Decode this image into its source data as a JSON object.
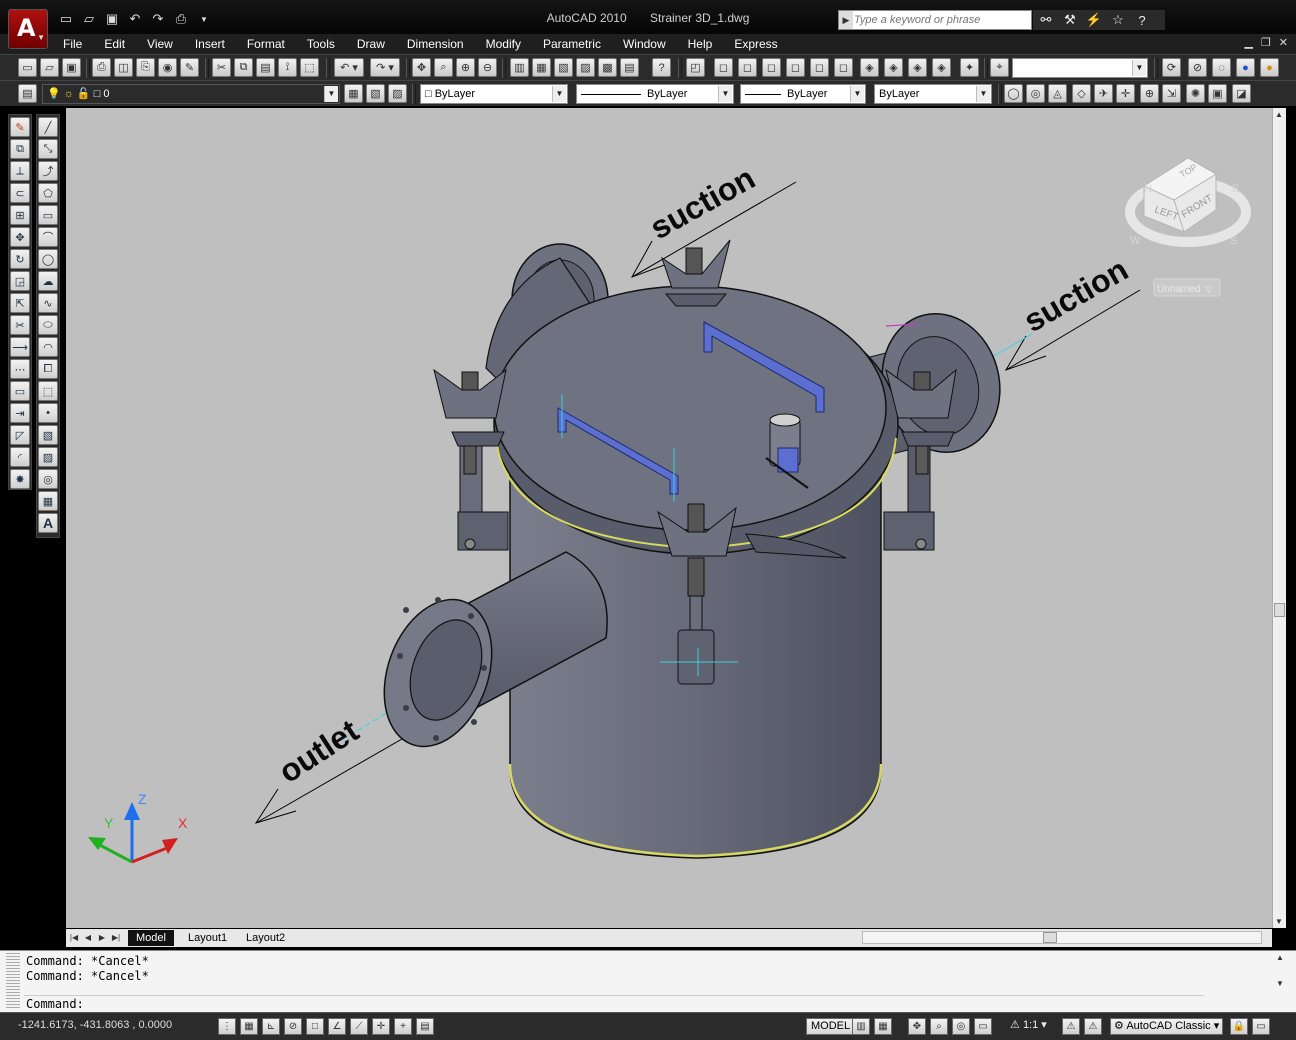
{
  "titlebar": {
    "app_name": "AutoCAD 2010",
    "document": "Strainer 3D_1.dwg",
    "search_placeholder": "Type a keyword or phrase"
  },
  "menu": [
    "File",
    "Edit",
    "View",
    "Insert",
    "Format",
    "Tools",
    "Draw",
    "Dimension",
    "Modify",
    "Parametric",
    "Window",
    "Help",
    "Express"
  ],
  "layers": {
    "current_layer": "0",
    "color": "ByLayer",
    "linetype": "ByLayer",
    "lineweight": "ByLayer",
    "plotstyle": "ByLayer"
  },
  "viewport": {
    "labels": {
      "suction_top": "suction",
      "suction_right": "suction",
      "outlet": "outlet"
    },
    "viewcube": {
      "top": "TOP",
      "left": "LEFT",
      "front": "FRONT",
      "compass_n": "N",
      "compass_s": "S",
      "compass_w": "W",
      "compass_e": "E",
      "ucs_menu": "Unnamed"
    },
    "ucs": {
      "x": "X",
      "y": "Y",
      "z": "Z"
    }
  },
  "tabs": [
    "Model",
    "Layout1",
    "Layout2"
  ],
  "command": {
    "history": [
      "Command: *Cancel*",
      "Command: *Cancel*"
    ],
    "prompt": "Command:"
  },
  "status": {
    "coords": "-1241.6173, -431.8063 , 0.0000",
    "space": "MODEL",
    "annotation_scale": "1:1",
    "workspace": "AutoCAD Classic"
  },
  "colors": {
    "viewport_bg": "#bfbfbf",
    "body_shade": "#6b6d7a",
    "accent_yellow": "#d8d860",
    "handle_blue": "#5c6ed0",
    "dim_cyan": "#39d3e0"
  }
}
